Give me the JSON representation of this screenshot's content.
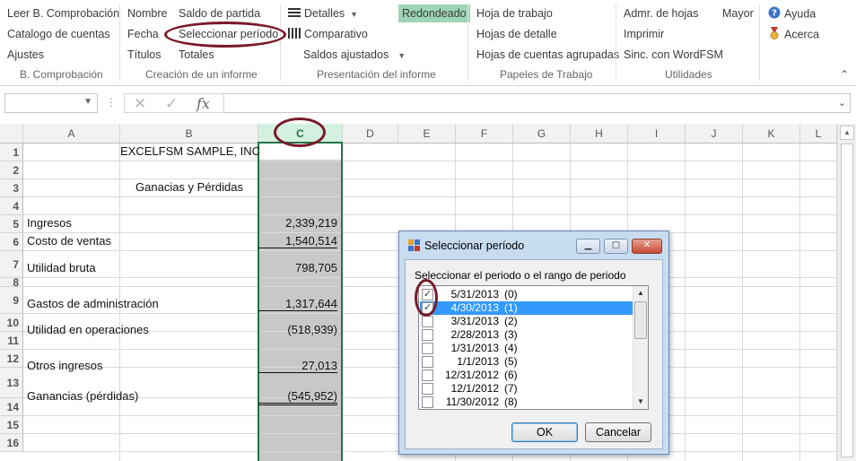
{
  "ribbon": {
    "b_comprobacion": {
      "items": [
        "Leer B. Comprobación",
        "Catalogo de cuentas",
        "Ajustes"
      ],
      "label": "B. Comprobación"
    },
    "creacion": {
      "col1": [
        "Nombre",
        "Fecha",
        "Títulos"
      ],
      "col2": [
        "Saldo de partida",
        "Seleccionar período",
        "Totales"
      ],
      "label": "Creación de un informe"
    },
    "presentacion": {
      "detalles": "Detalles",
      "comparativo": "Comparativo",
      "saldos_ajustados": "Saldos ajustados",
      "redondeado": "Redondeado",
      "label": "Presentación del informe"
    },
    "papeles": {
      "items": [
        "Hoja de trabajo",
        "Hojas de detalle",
        "Hojas de cuentas agrupadas"
      ],
      "label": "Papeles de Trabajo"
    },
    "utilidades": {
      "items": [
        "Admr. de hojas",
        "Imprimir",
        "Sinc. con WordFSM"
      ],
      "mayor": "Mayor",
      "label": "Utilidades"
    },
    "ayuda": {
      "ayuda": "Ayuda",
      "acerca": "Acerca"
    }
  },
  "formula_bar": {
    "name_box": "",
    "fx_label": "fx",
    "formula": ""
  },
  "columns": [
    "A",
    "B",
    "C",
    "D",
    "E",
    "F",
    "G",
    "H",
    "I",
    "J",
    "K",
    "L"
  ],
  "rows": [
    "1",
    "2",
    "3",
    "4",
    "5",
    "6",
    "7",
    "8",
    "9",
    "10",
    "11",
    "12",
    "13",
    "14",
    "15",
    "16"
  ],
  "sheet": {
    "company": "EXCELFSM SAMPLE, INC",
    "report_title": "Ganacias y Pérdidas",
    "lines": [
      {
        "label": "Ingresos",
        "value": "2,339,219"
      },
      {
        "label": "Costo de ventas",
        "value": "1,540,514"
      },
      {
        "label": "Utilidad bruta",
        "value": "798,705"
      },
      {
        "label": "Gastos de administración",
        "value": "1,317,644"
      },
      {
        "label": "Utilidad en operaciones",
        "value": "(518,939)"
      },
      {
        "label": "Otros ingresos",
        "value": "27,013"
      },
      {
        "label": "Ganancias (pérdidas)",
        "value": "(545,952)"
      }
    ]
  },
  "dialog": {
    "title": "Seleccionar período",
    "prompt": "Seleccionar el periodo o el rango de periodo",
    "periods": [
      {
        "date": "5/31/2013",
        "idx": "(0)",
        "checked": true,
        "selected": false
      },
      {
        "date": "4/30/2013",
        "idx": "(1)",
        "checked": true,
        "selected": true
      },
      {
        "date": "3/31/2013",
        "idx": "(2)",
        "checked": false,
        "selected": false
      },
      {
        "date": "2/28/2013",
        "idx": "(3)",
        "checked": false,
        "selected": false
      },
      {
        "date": "1/31/2013",
        "idx": "(4)",
        "checked": false,
        "selected": false
      },
      {
        "date": "1/1/2013",
        "idx": "(5)",
        "checked": false,
        "selected": false
      },
      {
        "date": "12/31/2012",
        "idx": "(6)",
        "checked": false,
        "selected": false
      },
      {
        "date": "12/1/2012",
        "idx": "(7)",
        "checked": false,
        "selected": false
      },
      {
        "date": "11/30/2012",
        "idx": "(8)",
        "checked": false,
        "selected": false
      }
    ],
    "ok": "OK",
    "cancel": "Cancelar"
  },
  "colors": {
    "excel_green": "#217346",
    "selected_column_fill": "#c8c8c8",
    "highlight_button": "#9fd5b7",
    "list_selection": "#3399ff",
    "annotation_oval": "#7a1a2a"
  }
}
